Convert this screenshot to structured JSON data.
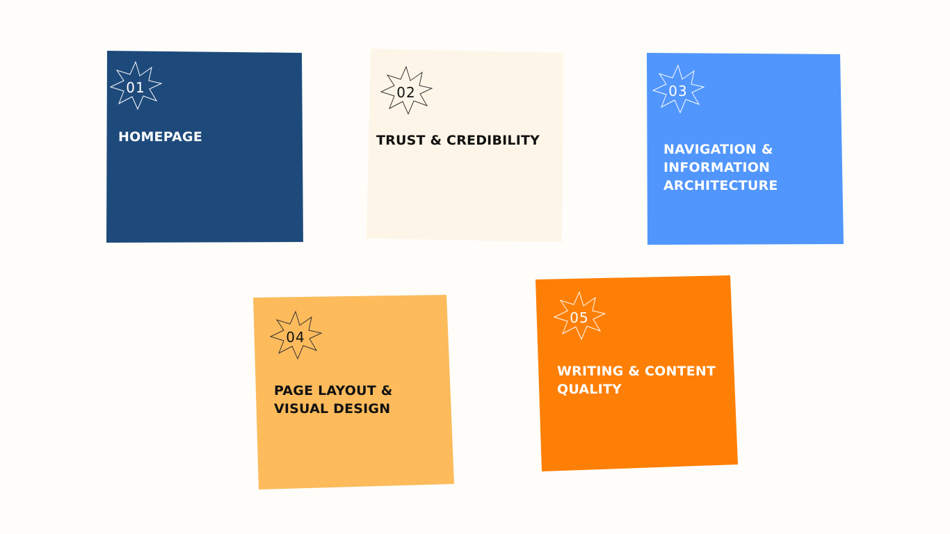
{
  "cards": [
    {
      "number": "01",
      "title": "HOMEPAGE",
      "color": "#1e4a7b",
      "text_color": "#ffffff"
    },
    {
      "number": "02",
      "title": "TRUST & CREDIBILITY",
      "color": "#fdf6e8",
      "text_color": "#111111"
    },
    {
      "number": "03",
      "title": "NAVIGATION &\nINFORMATION\nARCHITECTURE",
      "color": "#5196fc",
      "text_color": "#ffffff"
    },
    {
      "number": "04",
      "title": "PAGE LAYOUT &\nVISUAL DESIGN",
      "color": "#fdbb5c",
      "text_color": "#111111"
    },
    {
      "number": "05",
      "title": "WRITING & CONTENT\nQUALITY",
      "color": "#fe7f06",
      "text_color": "#ffffff"
    }
  ],
  "icons": {
    "badge": "star-burst-icon"
  }
}
